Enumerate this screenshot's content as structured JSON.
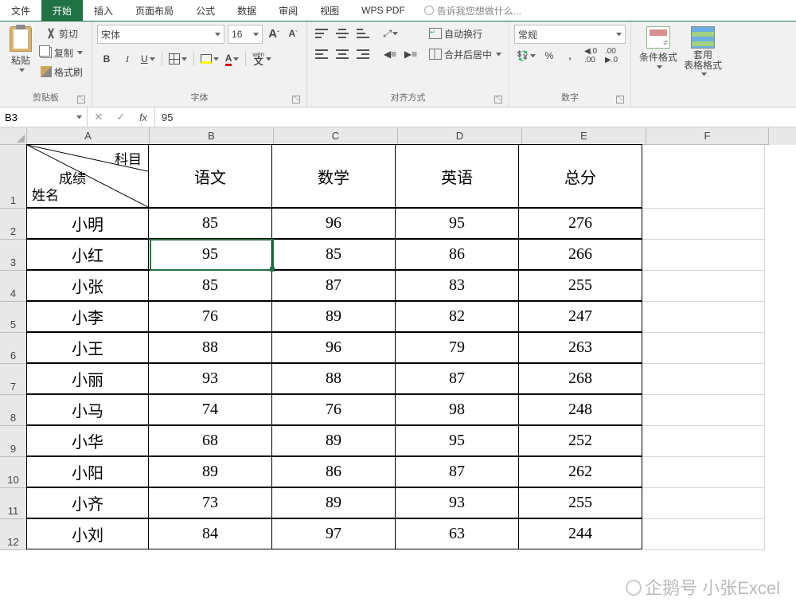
{
  "menu": {
    "file": "文件",
    "home": "开始",
    "insert": "插入",
    "layout": "页面布局",
    "formula": "公式",
    "data": "数据",
    "review": "审阅",
    "view": "视图",
    "wpspdf": "WPS PDF",
    "tell": "告诉我您想做什么..."
  },
  "ribbon": {
    "clipboard": {
      "paste": "粘贴",
      "cut": "剪切",
      "copy": "复制",
      "brush": "格式刷",
      "label": "剪贴板"
    },
    "font": {
      "family": "宋体",
      "size": "16",
      "bold": "B",
      "italic": "I",
      "underline": "U",
      "label": "字体",
      "incA": "A",
      "decA": "A",
      "ruby": "wén",
      "charA": "A"
    },
    "align": {
      "wrap": "自动换行",
      "merge": "合并后居中",
      "label": "对齐方式"
    },
    "number": {
      "format": "常规",
      "percent": "%",
      "comma": ",",
      "inc": ".0",
      "dec": ".00",
      "label": "数字"
    },
    "styles": {
      "cond": "条件格式",
      "table": "套用\n表格格式"
    }
  },
  "namebox": "B3",
  "formula": "95",
  "cols": [
    "A",
    "B",
    "C",
    "D",
    "E",
    "F"
  ],
  "header": {
    "diag1": "科目",
    "diag2": "成绩",
    "diag3": "姓名",
    "b": "语文",
    "c": "数学",
    "d": "英语",
    "e": "总分"
  },
  "rows": [
    {
      "n": "2",
      "a": "小明",
      "b": "85",
      "c": "96",
      "d": "95",
      "e": "276"
    },
    {
      "n": "3",
      "a": "小红",
      "b": "95",
      "c": "85",
      "d": "86",
      "e": "266"
    },
    {
      "n": "4",
      "a": "小张",
      "b": "85",
      "c": "87",
      "d": "83",
      "e": "255"
    },
    {
      "n": "5",
      "a": "小李",
      "b": "76",
      "c": "89",
      "d": "82",
      "e": "247"
    },
    {
      "n": "6",
      "a": "小王",
      "b": "88",
      "c": "96",
      "d": "79",
      "e": "263"
    },
    {
      "n": "7",
      "a": "小丽",
      "b": "93",
      "c": "88",
      "d": "87",
      "e": "268"
    },
    {
      "n": "8",
      "a": "小马",
      "b": "74",
      "c": "76",
      "d": "98",
      "e": "248"
    },
    {
      "n": "9",
      "a": "小华",
      "b": "68",
      "c": "89",
      "d": "95",
      "e": "252"
    },
    {
      "n": "10",
      "a": "小阳",
      "b": "89",
      "c": "86",
      "d": "87",
      "e": "262"
    },
    {
      "n": "11",
      "a": "小齐",
      "b": "73",
      "c": "89",
      "d": "93",
      "e": "255"
    },
    {
      "n": "12",
      "a": "小刘",
      "b": "84",
      "c": "97",
      "d": "63",
      "e": "244"
    }
  ],
  "watermark": "企鹅号 小张Excel"
}
